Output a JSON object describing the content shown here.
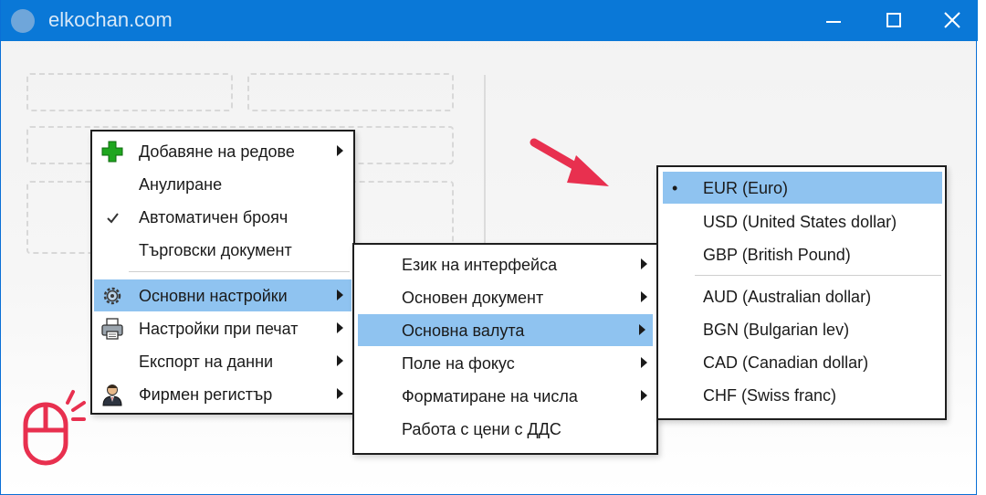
{
  "window": {
    "title": "elkochan.com",
    "controls": [
      "minimize-icon",
      "maximize-icon",
      "close-icon"
    ]
  },
  "menu_main": {
    "items": [
      {
        "label": "Добавяне на редове",
        "icon": "green-plus-icon",
        "submenu": true
      },
      {
        "label": "Анулиране",
        "icon": "",
        "submenu": false
      },
      {
        "label": "Автоматичен брояч",
        "icon": "checkmark-icon",
        "checked": true,
        "submenu": false
      },
      {
        "label": "Търговски документ",
        "icon": "",
        "submenu": false
      },
      {
        "label": "Основни настройки",
        "icon": "gear-icon",
        "submenu": true,
        "highlighted": true
      },
      {
        "label": "Настройки при печат",
        "icon": "printer-icon",
        "submenu": true
      },
      {
        "label": "Експорт на данни",
        "icon": "",
        "submenu": true
      },
      {
        "label": "Фирмен регистър",
        "icon": "businessman-icon",
        "submenu": true
      }
    ]
  },
  "menu_settings": {
    "items": [
      {
        "label": "Език на интерфейса",
        "submenu": true
      },
      {
        "label": "Основен документ",
        "submenu": true
      },
      {
        "label": "Основна валута",
        "submenu": true,
        "highlighted": true
      },
      {
        "label": "Поле на фокус",
        "submenu": true
      },
      {
        "label": "Форматиране на числа",
        "submenu": true
      },
      {
        "label": "Работа с цени с ДДС",
        "submenu": false
      }
    ]
  },
  "menu_currency": {
    "items": [
      {
        "label": "EUR (Euro)",
        "selected": true,
        "highlighted": true
      },
      {
        "label": "USD (United States dollar)"
      },
      {
        "label": "GBP (British Pound)"
      },
      {
        "label": "AUD (Australian dollar)"
      },
      {
        "label": "BGN (Bulgarian lev)"
      },
      {
        "label": "CAD (Canadian dollar)"
      },
      {
        "label": "CHF (Swiss franc)"
      }
    ],
    "selected_marker": "•"
  },
  "colors": {
    "titlebar": "#0a78d7",
    "highlight": "#8fc3f0",
    "accent_red": "#e8304f",
    "plus_green": "#1fa61f"
  },
  "decorations": {
    "pointer_arrow": "red-arrow-icon",
    "mouse": "mouse-click-icon"
  }
}
